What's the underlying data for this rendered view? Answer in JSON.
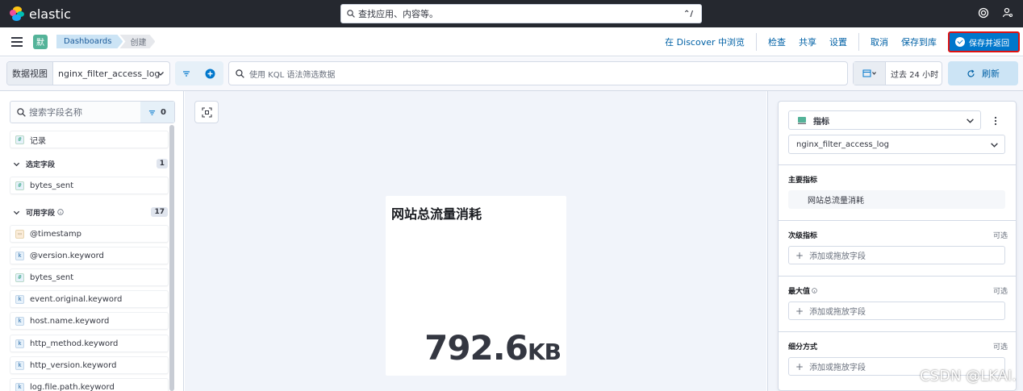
{
  "header": {
    "brand": "elastic",
    "search_placeholder": "查找应用、内容等。",
    "search_shortcut": "⌃/"
  },
  "nav": {
    "space_initial": "默",
    "breadcrumbs": [
      "Dashboards",
      "创建"
    ],
    "actions": [
      "在 Discover 中浏览",
      "检查",
      "共享",
      "设置",
      "取消",
      "保存到库"
    ],
    "save_return": "保存并返回"
  },
  "query": {
    "data_view_label": "数据视图",
    "data_view_value": "nginx_filter_access_log",
    "kql_placeholder": "使用 KQL 语法筛选数据",
    "time_range": "过去 24 小时",
    "refresh": "刷新"
  },
  "fields": {
    "search_placeholder": "搜索字段名称",
    "filter_count": "0",
    "records": "记录",
    "selected_title": "选定字段",
    "selected_count": "1",
    "selected": [
      {
        "name": "bytes_sent",
        "type": "#"
      }
    ],
    "available_title": "可用字段",
    "available_count": "17",
    "available": [
      {
        "name": "@timestamp",
        "type": "date"
      },
      {
        "name": "@version.keyword",
        "type": "k"
      },
      {
        "name": "bytes_sent",
        "type": "#"
      },
      {
        "name": "event.original.keyword",
        "type": "k"
      },
      {
        "name": "host.name.keyword",
        "type": "k"
      },
      {
        "name": "http_method.keyword",
        "type": "k"
      },
      {
        "name": "http_version.keyword",
        "type": "k"
      },
      {
        "name": "log.file.path.keyword",
        "type": "k"
      }
    ]
  },
  "metric": {
    "title": "网站总流量消耗",
    "value": "792.6",
    "unit": "KB"
  },
  "config": {
    "viz_type": "指标",
    "data_view": "nginx_filter_access_log",
    "primary_title": "主要指标",
    "primary_value": "网站总流量消耗",
    "secondary_title": "次级指标",
    "max_title": "最大值",
    "breakdown_title": "细分方式",
    "optional": "可选",
    "add_field": "添加或拖放字段"
  },
  "watermark": "CSDN @LKAI."
}
